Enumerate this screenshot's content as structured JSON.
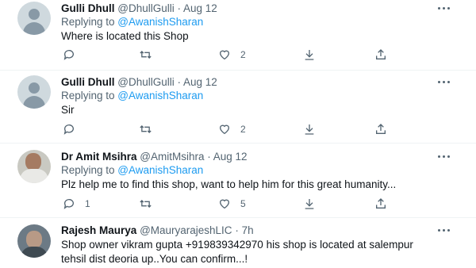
{
  "tweets": [
    {
      "name": "Gulli Dhull",
      "handle": "@DhullGulli",
      "separator": "·",
      "date": "Aug 12",
      "replying_prefix": "Replying to ",
      "replying_to": "@AwanishSharan",
      "text": [
        "Where is located this Shop"
      ],
      "reply_count": "",
      "like_count": "2",
      "avatar": "default-avatar"
    },
    {
      "name": "Gulli Dhull",
      "handle": "@DhullGulli",
      "separator": "·",
      "date": "Aug 12",
      "replying_prefix": "Replying to ",
      "replying_to": "@AwanishSharan",
      "text": [
        "Sir"
      ],
      "reply_count": "",
      "like_count": "2",
      "avatar": "default-avatar"
    },
    {
      "name": "Dr Amit Msihra",
      "handle": "@AmitMsihra",
      "separator": "·",
      "date": "Aug 12",
      "replying_prefix": "Replying to ",
      "replying_to": "@AwanishSharan",
      "text": [
        "Plz help me to find this shop, want to help him for this great humanity..."
      ],
      "reply_count": "1",
      "like_count": "5",
      "avatar": "photo-avatar"
    },
    {
      "name": "Rajesh Maurya",
      "handle": "@MauryarajeshLIC",
      "separator": "·",
      "date": "7h",
      "text": [
        "Shop owner vikram gupta +919839342970 his shop is located at salempur",
        "tehsil dist deoria up..You can confirm...!"
      ],
      "avatar": "photo-avatar"
    }
  ],
  "icons": {
    "reply": "reply-icon",
    "retweet": "retweet-icon",
    "like": "like-icon",
    "download": "download-icon",
    "share": "share-icon",
    "more": "more-icon"
  },
  "colors": {
    "text": "#0f1419",
    "secondary": "#536471",
    "link": "#1d9bf0",
    "divider": "#eff3f4"
  }
}
